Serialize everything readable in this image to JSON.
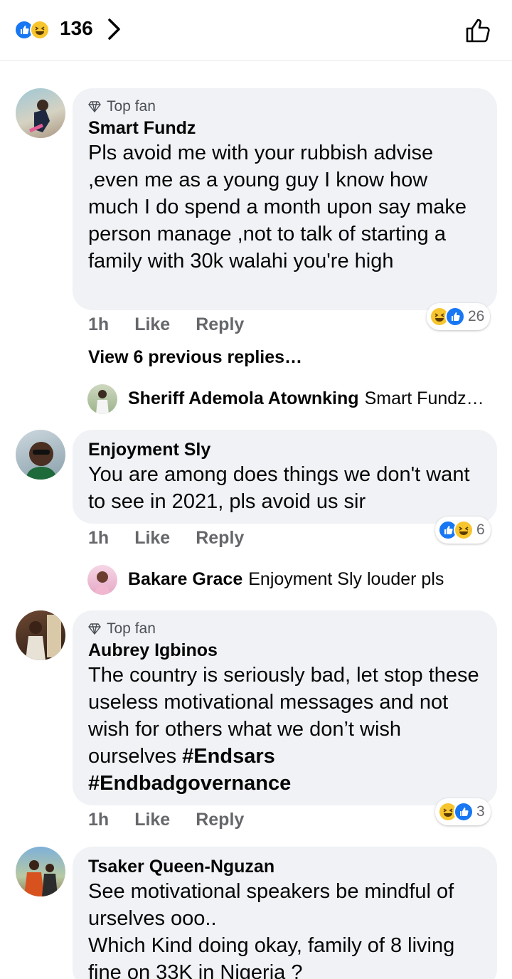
{
  "header": {
    "reaction_count": "136",
    "reactions": [
      "like-icon",
      "haha-icon"
    ],
    "icons": {
      "chevron": "chevron-right-icon",
      "like": "thumbs-up-outline-icon"
    }
  },
  "colors": {
    "like_blue": "#1877f2",
    "haha_yellow": "#f7c52e",
    "bubble": "#f0f2f5",
    "meta_grey": "#65676b"
  },
  "comments": [
    {
      "badge": "Top fan",
      "author": "Smart Fundz",
      "text": "Pls avoid me with your rubbish advise ,even me as a young guy I know how much I do spend a month upon say make person manage ,not to talk of starting a family with 30k walahi you're high",
      "time": "1h",
      "like_label": "Like",
      "reply_label": "Reply",
      "reaction_count": "26"
    },
    {
      "author": "Enjoyment Sly",
      "text": "You are among does things we don't want to see in 2021,  pls avoid us sir",
      "time": "1h",
      "like_label": "Like",
      "reply_label": "Reply",
      "reaction_count": "6"
    },
    {
      "badge": "Top fan",
      "author": "Aubrey Igbinos",
      "text_plain": "The country is seriously bad, let stop these useless motivational messages and not wish for others what we don’t wish ourselves ",
      "hashtag1": "#Endsars",
      "hashtag2": "#Endbadgovernance",
      "time": "1h",
      "like_label": "Like",
      "reply_label": "Reply",
      "reaction_count": "3"
    },
    {
      "author": "Tsaker Queen-Nguzan",
      "text1": "See  motivational speakers be mindful of urselves ooo..",
      "text2": "Which Kind doing okay, family of 8 living fine on 33K in Nigeria  ?"
    }
  ],
  "view_previous": "View 6 previous replies…",
  "replies": [
    {
      "author": "Sheriff Ademola Atownking",
      "preview": "Smart Fundz…"
    },
    {
      "author": "Bakare Grace",
      "preview": "Enjoyment Sly louder pls"
    }
  ]
}
